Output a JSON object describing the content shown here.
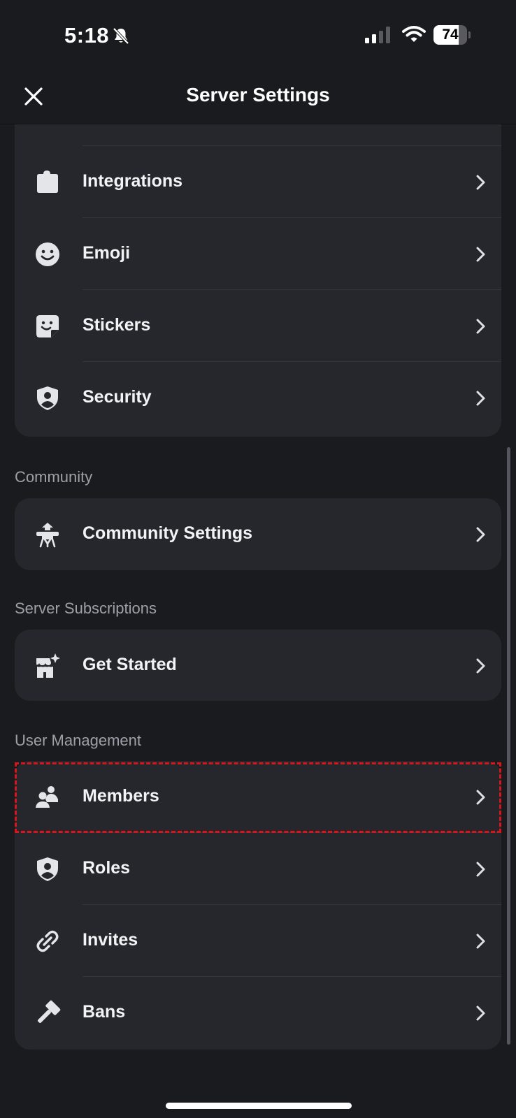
{
  "status_bar": {
    "time": "5:18",
    "battery_level": "74",
    "battery_fraction": 0.74
  },
  "header": {
    "title": "Server Settings"
  },
  "top_group": [
    {
      "label": "Integrations",
      "icon": "puzzle-icon"
    },
    {
      "label": "Emoji",
      "icon": "smiley-icon"
    },
    {
      "label": "Stickers",
      "icon": "sticker-icon"
    },
    {
      "label": "Security",
      "icon": "shield-user-icon"
    }
  ],
  "community": {
    "section_label": "Community",
    "items": [
      {
        "label": "Community Settings",
        "icon": "community-tower-icon"
      }
    ]
  },
  "subscriptions": {
    "section_label": "Server Subscriptions",
    "items": [
      {
        "label": "Get Started",
        "icon": "shop-sparkle-icon"
      }
    ]
  },
  "user_management": {
    "section_label": "User Management",
    "items": [
      {
        "label": "Members",
        "icon": "members-icon"
      },
      {
        "label": "Roles",
        "icon": "shield-user-icon"
      },
      {
        "label": "Invites",
        "icon": "link-icon"
      },
      {
        "label": "Bans",
        "icon": "hammer-icon"
      }
    ]
  },
  "colors": {
    "background": "#1a1b1f",
    "card": "#26272d",
    "text": "#f2f3f5",
    "section_text": "#9ea0a8",
    "highlight": "#d8151b"
  }
}
